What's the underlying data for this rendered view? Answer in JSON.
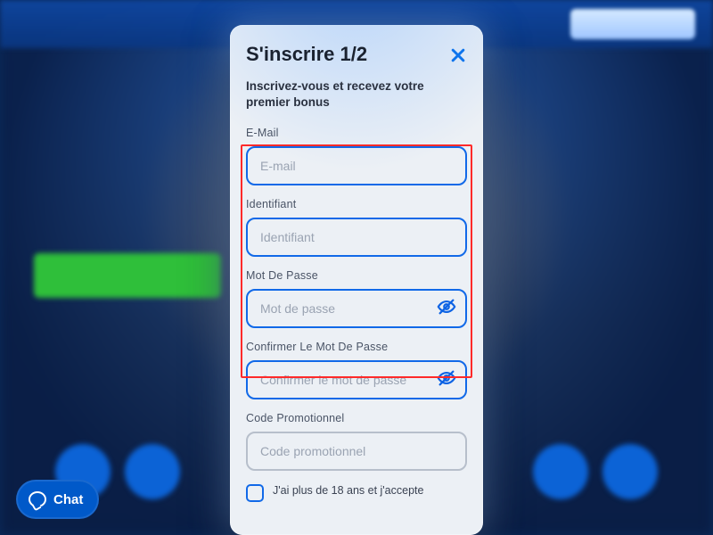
{
  "chat": {
    "label": "Chat"
  },
  "modal": {
    "title": "S'inscrire 1/2",
    "subtitle": "Inscrivez-vous et recevez votre premier bonus",
    "fields": {
      "email": {
        "label": "E-Mail",
        "placeholder": "E-mail"
      },
      "username": {
        "label": "Identifiant",
        "placeholder": "Identifiant"
      },
      "password": {
        "label": "Mot De Passe",
        "placeholder": "Mot de passe"
      },
      "confirm": {
        "label": "Confirmer Le Mot De Passe",
        "placeholder": "Confirmer le mot de passe"
      },
      "promo": {
        "label": "Code Promotionnel",
        "placeholder": "Code promotionnel"
      }
    },
    "agree_text": "J'ai plus de 18 ans et j'accepte"
  }
}
